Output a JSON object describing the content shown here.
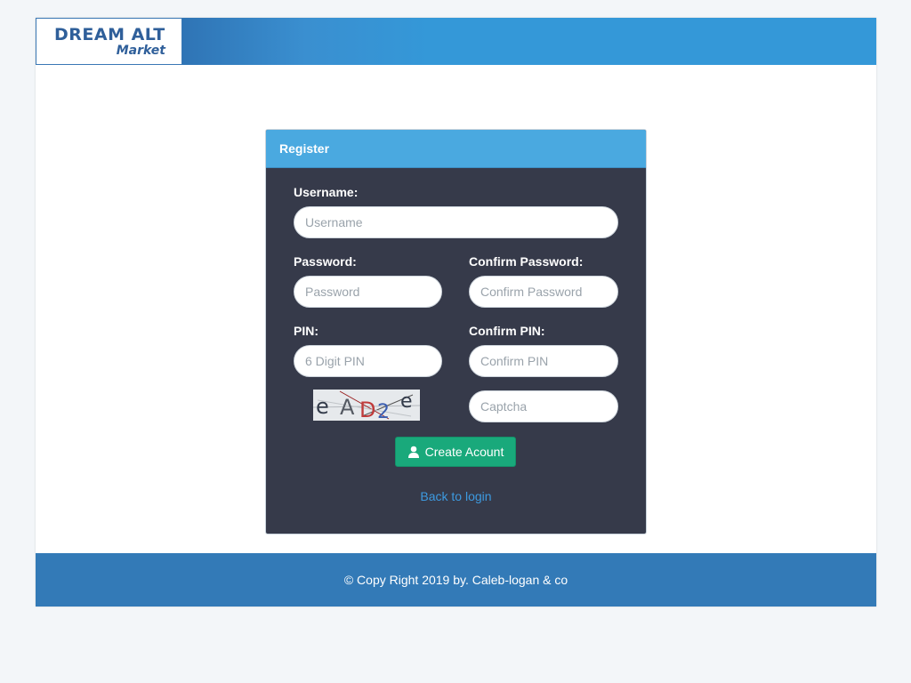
{
  "header": {
    "logo_line1": "DREAM ALT",
    "logo_line2": "Market"
  },
  "register": {
    "title": "Register",
    "username": {
      "label": "Username:",
      "placeholder": "Username"
    },
    "password": {
      "label": "Password:",
      "placeholder": "Password"
    },
    "confirm_password": {
      "label": "Confirm Password:",
      "placeholder": "Confirm Password"
    },
    "pin": {
      "label": "PIN:",
      "placeholder": "6 Digit PIN"
    },
    "confirm_pin": {
      "label": "Confirm PIN:",
      "placeholder": "Confirm PIN"
    },
    "captcha": {
      "image_text": "eAD2e",
      "placeholder": "Captcha"
    },
    "create_button": "Create Acount",
    "back_link": "Back to login"
  },
  "footer": {
    "text": "© Copy Right 2019 by. Caleb-logan & co"
  },
  "colors": {
    "header_blue": "#3498d8",
    "panel_heading": "#4aa9e0",
    "panel_body": "#363a4a",
    "create_button": "#19a97b",
    "footer_blue": "#337ab7",
    "link": "#3d9ae0"
  },
  "icons": {
    "create_button_icon": "user-icon"
  }
}
